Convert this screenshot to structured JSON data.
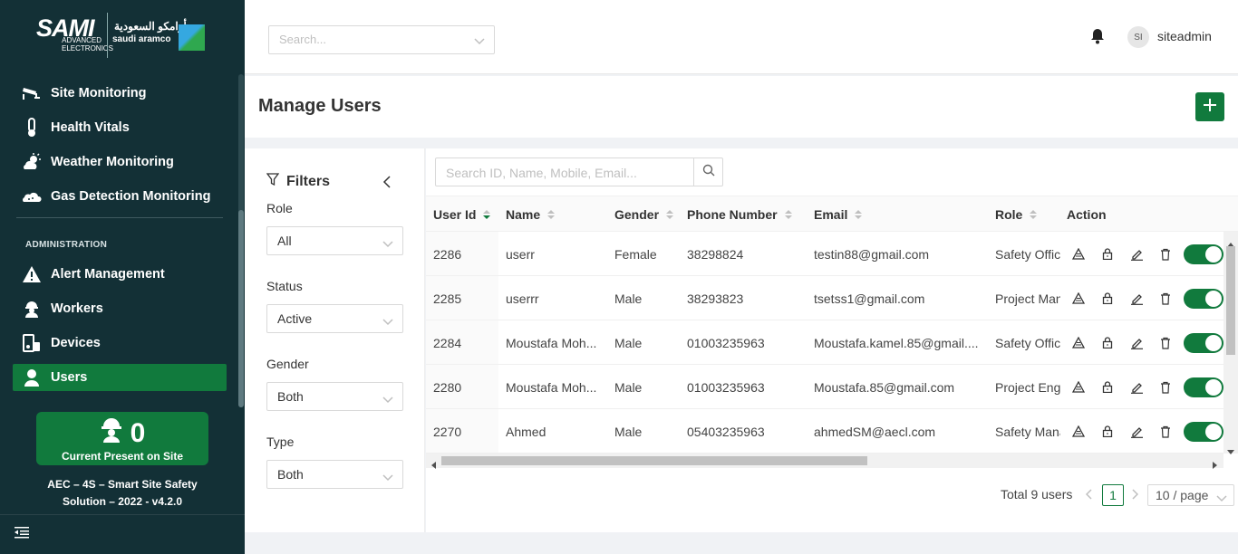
{
  "logo": {
    "brand": "SAMI",
    "sub": "ADVANCED ELECTRONICS",
    "partner": "saudi aramco",
    "partner_ar": "أرامكو السعودية"
  },
  "sidebar": {
    "items": [
      {
        "label": "Site Monitoring",
        "icon": "cctv-camera-icon"
      },
      {
        "label": "Health Vitals",
        "icon": "thermometer-icon"
      },
      {
        "label": "Weather Monitoring",
        "icon": "weather-icon"
      },
      {
        "label": "Gas Detection Monitoring",
        "icon": "gas-cloud-icon"
      }
    ],
    "admin_section": "ADMINISTRATION",
    "admin_items": [
      {
        "label": "Alert Management",
        "icon": "alert-icon"
      },
      {
        "label": "Workers",
        "icon": "worker-icon"
      },
      {
        "label": "Devices",
        "icon": "devices-icon"
      },
      {
        "label": "Users",
        "icon": "user-icon",
        "active": true
      }
    ],
    "present": {
      "count": "0",
      "label": "Current Present on Site"
    },
    "version_line1": "AEC – 4S – Smart Site Safety",
    "version_line2": "Solution – 2022 - v4.2.0"
  },
  "header": {
    "search_placeholder": "Search...",
    "avatar_initials": "SI",
    "username": "siteadmin"
  },
  "page": {
    "title": "Manage Users"
  },
  "filters": {
    "title": "Filters",
    "role_label": "Role",
    "role_value": "All",
    "status_label": "Status",
    "status_value": "Active",
    "gender_label": "Gender",
    "gender_value": "Both",
    "type_label": "Type",
    "type_value": "Both"
  },
  "table": {
    "search_placeholder": "Search ID, Name, Mobile, Email...",
    "columns": [
      "User Id",
      "Name",
      "Gender",
      "Phone Number",
      "Email",
      "Role",
      "Action"
    ],
    "rows": [
      {
        "id": "2286",
        "name": "userr",
        "gender": "Female",
        "phone": "38298824",
        "email": "testin88@gmail.com",
        "role": "Safety Officer"
      },
      {
        "id": "2285",
        "name": "userrr",
        "gender": "Male",
        "phone": "38293823",
        "email": "tsetss1@gmail.com",
        "role": "Project Manager"
      },
      {
        "id": "2284",
        "name": "Moustafa Moh...",
        "gender": "Male",
        "phone": "01003235963",
        "email": "Moustafa.kamel.85@gmail....",
        "role": "Safety Officer"
      },
      {
        "id": "2280",
        "name": "Moustafa Moh...",
        "gender": "Male",
        "phone": "01003235963",
        "email": "Moustafa.85@gmail.com",
        "role": "Project Engineer"
      },
      {
        "id": "2270",
        "name": "Ahmed",
        "gender": "Male",
        "phone": "05403235963",
        "email": "ahmedSM@aecl.com",
        "role": "Safety Manager"
      }
    ]
  },
  "pagination": {
    "total": "Total 9 users",
    "current": "1",
    "size": "10 / page"
  },
  "colors": {
    "sidebar": "#133036",
    "accent": "#117a3d"
  }
}
